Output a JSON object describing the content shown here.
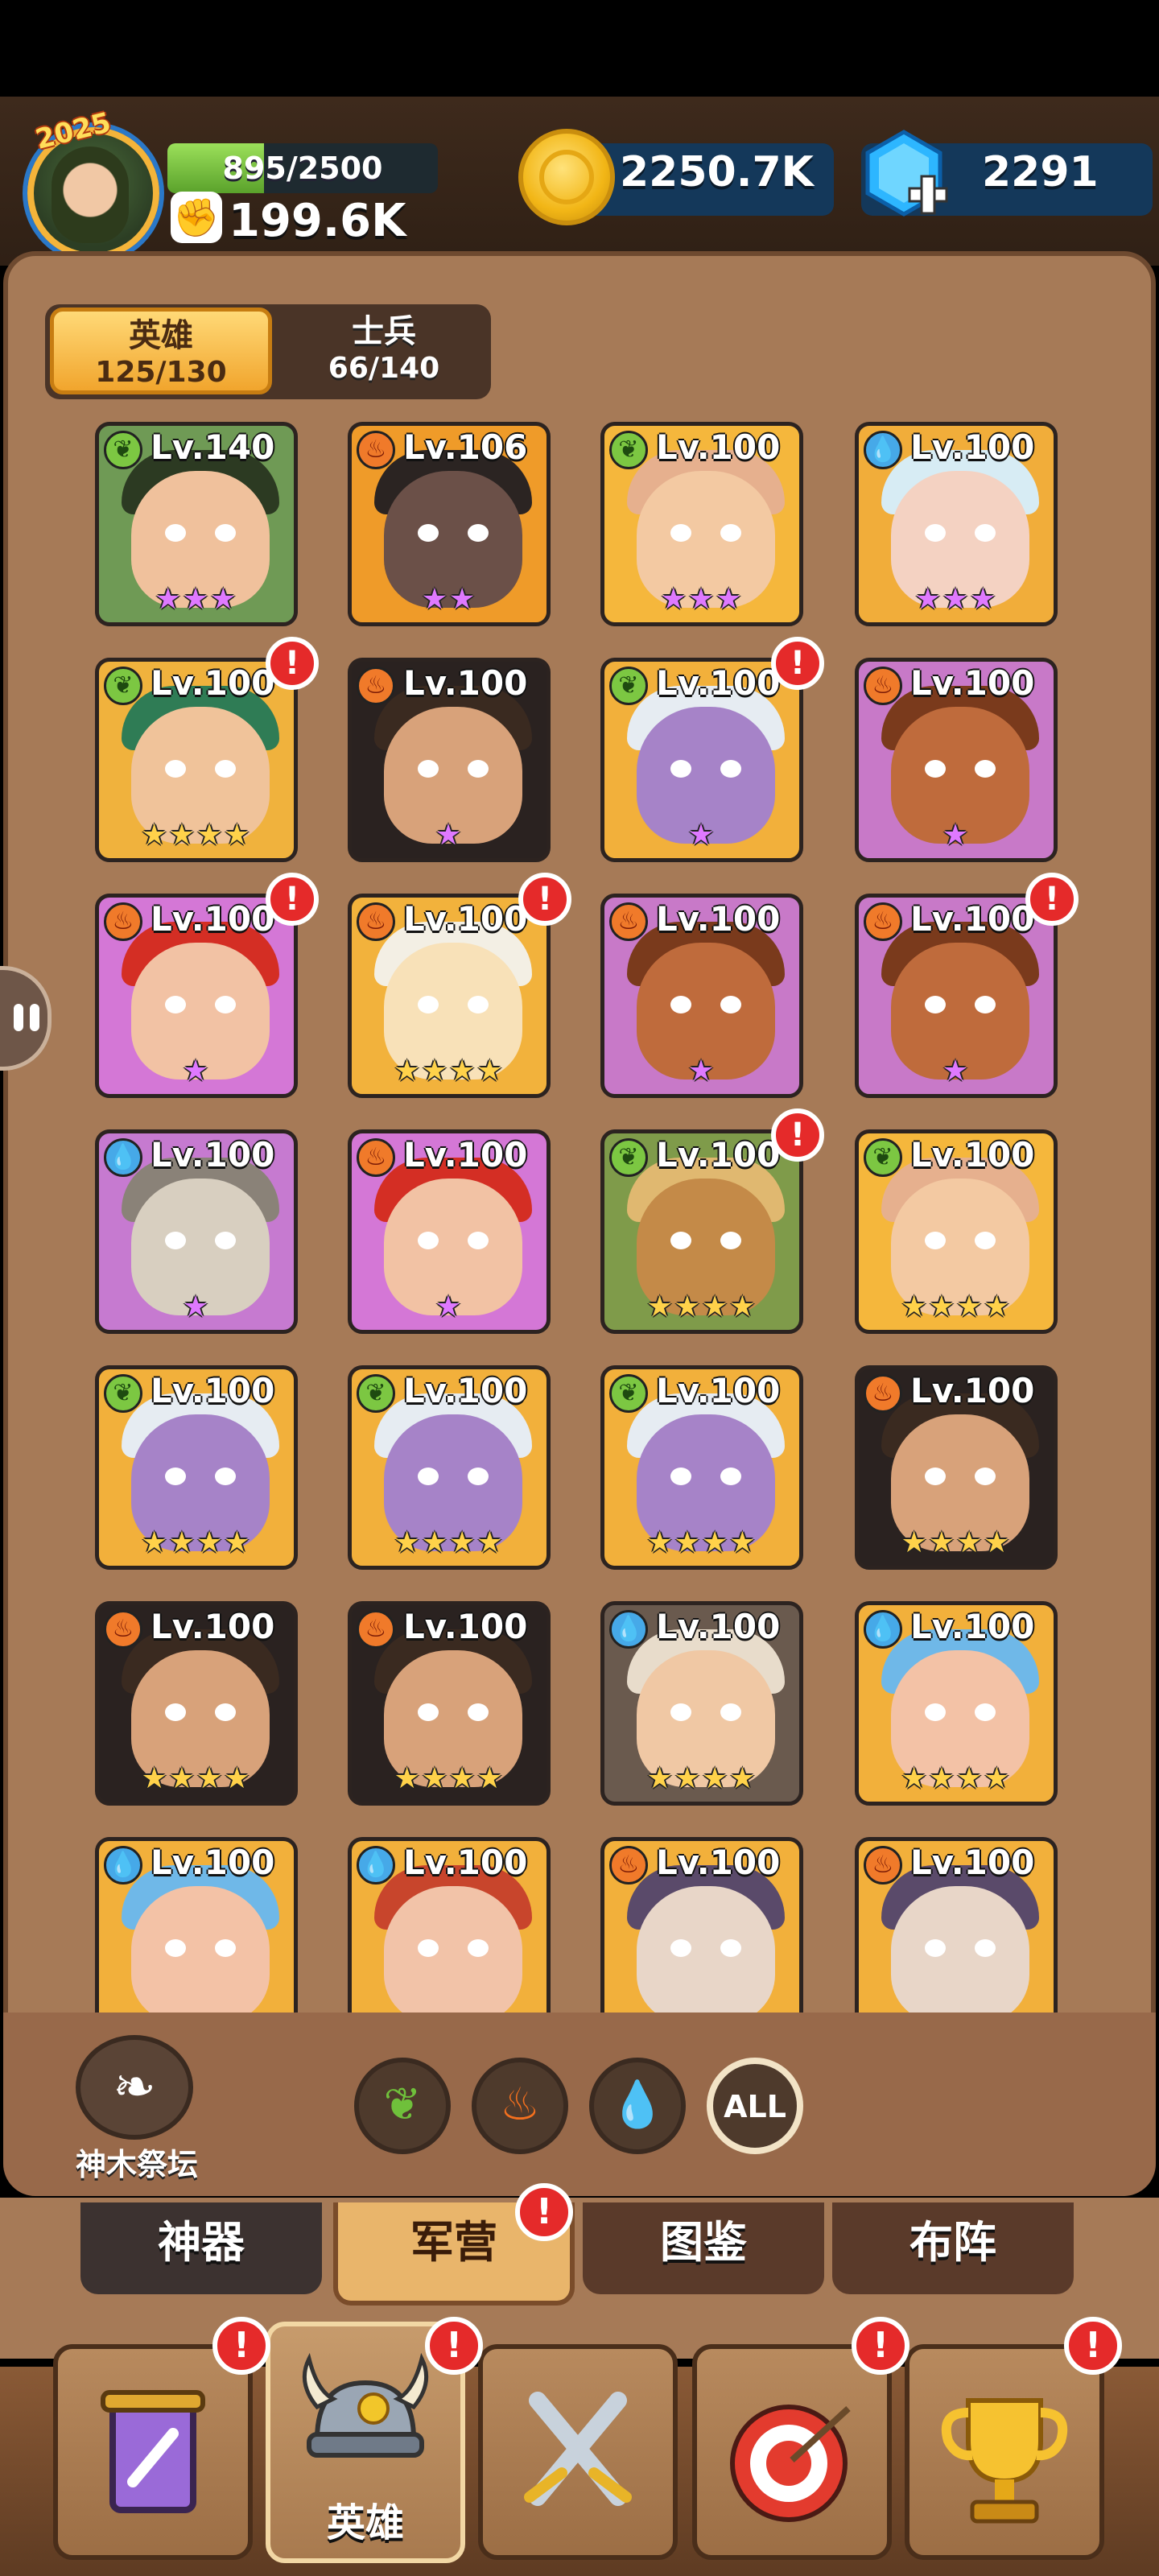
{
  "header": {
    "year_badge": "2025",
    "xp": "895/2500",
    "xp_fraction": 0.358,
    "power": "199.6K",
    "coins": "2250.7K",
    "gems": "2291"
  },
  "tabs": {
    "heroes": {
      "label": "英雄",
      "count": "125/130"
    },
    "soldiers": {
      "label": "士兵",
      "count": "66/140"
    }
  },
  "heroes": [
    {
      "element": "leaf",
      "level": "Lv.140",
      "stars": 3,
      "star_color": "purple",
      "alert": false,
      "bg": "#6f9a55",
      "skin": "#f0c19c",
      "hair": "#2c3a22"
    },
    {
      "element": "fire",
      "level": "Lv.106",
      "stars": 2,
      "star_color": "purple",
      "alert": false,
      "bg": "#ef9b29",
      "skin": "#6b5048",
      "hair": "#2b2422"
    },
    {
      "element": "leaf",
      "level": "Lv.100",
      "stars": 3,
      "star_color": "purple",
      "alert": false,
      "bg": "#f5b73c",
      "skin": "#f3c9a2",
      "hair": "#e6b08e"
    },
    {
      "element": "water",
      "level": "Lv.100",
      "stars": 3,
      "star_color": "purple",
      "alert": false,
      "bg": "#f1ad3a",
      "skin": "#f4d2c2",
      "hair": "#d7ecf4"
    },
    {
      "element": "leaf",
      "level": "Lv.100",
      "stars": 4,
      "star_color": "gold",
      "alert": true,
      "bg": "#f0b23d",
      "skin": "#f0c39a",
      "hair": "#2f7c55"
    },
    {
      "element": "fire",
      "level": "Lv.100",
      "stars": 1,
      "star_color": "purple",
      "alert": false,
      "bg": "#2a2220",
      "skin": "#d8a27a",
      "hair": "#3a2a20"
    },
    {
      "element": "leaf",
      "level": "Lv.100",
      "stars": 1,
      "star_color": "purple",
      "alert": true,
      "bg": "#f2b03b",
      "skin": "#a683c8",
      "hair": "#e6ecf2"
    },
    {
      "element": "fire",
      "level": "Lv.100",
      "stars": 1,
      "star_color": "purple",
      "alert": false,
      "bg": "#c879c8",
      "skin": "#bf6b3c",
      "hair": "#7a3a1c"
    },
    {
      "element": "fire",
      "level": "Lv.100",
      "stars": 1,
      "star_color": "purple",
      "alert": true,
      "bg": "#d477d6",
      "skin": "#f2c2a4",
      "hair": "#d42e24"
    },
    {
      "element": "fire",
      "level": "Lv.100",
      "stars": 4,
      "star_color": "gold",
      "alert": true,
      "bg": "#f2b23c",
      "skin": "#f8e1b8",
      "hair": "#f3efe4"
    },
    {
      "element": "fire",
      "level": "Lv.100",
      "stars": 1,
      "star_color": "purple",
      "alert": false,
      "bg": "#c879c8",
      "skin": "#bf6b3c",
      "hair": "#7a3a1c"
    },
    {
      "element": "fire",
      "level": "Lv.100",
      "stars": 1,
      "star_color": "purple",
      "alert": true,
      "bg": "#c879c8",
      "skin": "#bf6b3c",
      "hair": "#7a3a1c"
    },
    {
      "element": "water",
      "level": "Lv.100",
      "stars": 1,
      "star_color": "purple",
      "alert": false,
      "bg": "#c67ad0",
      "skin": "#d8cfc0",
      "hair": "#8a8278"
    },
    {
      "element": "fire",
      "level": "Lv.100",
      "stars": 1,
      "star_color": "purple",
      "alert": false,
      "bg": "#d477d6",
      "skin": "#f2c2a4",
      "hair": "#d42e24"
    },
    {
      "element": "leaf",
      "level": "Lv.100",
      "stars": 4,
      "star_color": "gold",
      "alert": true,
      "bg": "#7f9b4a",
      "skin": "#c48a48",
      "hair": "#e0b870"
    },
    {
      "element": "leaf",
      "level": "Lv.100",
      "stars": 4,
      "star_color": "gold",
      "alert": false,
      "bg": "#f5b73c",
      "skin": "#f3c9a2",
      "hair": "#e6b08e"
    },
    {
      "element": "leaf",
      "level": "Lv.100",
      "stars": 4,
      "star_color": "gold",
      "alert": false,
      "bg": "#f2b03b",
      "skin": "#a683c8",
      "hair": "#e6ecf2"
    },
    {
      "element": "leaf",
      "level": "Lv.100",
      "stars": 4,
      "star_color": "gold",
      "alert": false,
      "bg": "#f2b03b",
      "skin": "#a683c8",
      "hair": "#e6ecf2"
    },
    {
      "element": "leaf",
      "level": "Lv.100",
      "stars": 4,
      "star_color": "gold",
      "alert": false,
      "bg": "#f2b03b",
      "skin": "#a683c8",
      "hair": "#e6ecf2"
    },
    {
      "element": "fire",
      "level": "Lv.100",
      "stars": 4,
      "star_color": "gold",
      "alert": false,
      "bg": "#2a2220",
      "skin": "#d8a27a",
      "hair": "#3a2a20"
    },
    {
      "element": "fire",
      "level": "Lv.100",
      "stars": 4,
      "star_color": "gold",
      "alert": false,
      "bg": "#2a2220",
      "skin": "#d8a27a",
      "hair": "#3a2a20"
    },
    {
      "element": "fire",
      "level": "Lv.100",
      "stars": 4,
      "star_color": "gold",
      "alert": false,
      "bg": "#2a2220",
      "skin": "#d8a27a",
      "hair": "#3a2a20"
    },
    {
      "element": "water",
      "level": "Lv.100",
      "stars": 4,
      "star_color": "gold",
      "alert": false,
      "bg": "#6a5a4e",
      "skin": "#f0c8a4",
      "hair": "#e8dccb"
    },
    {
      "element": "water",
      "level": "Lv.100",
      "stars": 4,
      "star_color": "gold",
      "alert": false,
      "bg": "#f2b03b",
      "skin": "#f3c2a6",
      "hair": "#6fb8e8"
    },
    {
      "element": "water",
      "level": "Lv.100",
      "stars": 0,
      "star_color": "gold",
      "alert": false,
      "bg": "#f2b03b",
      "skin": "#f3c2a6",
      "hair": "#6fb8e8"
    },
    {
      "element": "water",
      "level": "Lv.100",
      "stars": 0,
      "star_color": "gold",
      "alert": false,
      "bg": "#f2b03b",
      "skin": "#f2c3a8",
      "hair": "#c8452c"
    },
    {
      "element": "fire",
      "level": "Lv.100",
      "stars": 0,
      "star_color": "gold",
      "alert": false,
      "bg": "#f2b03b",
      "skin": "#e8d6c8",
      "hair": "#5a4a6a"
    },
    {
      "element": "fire",
      "level": "Lv.100",
      "stars": 0,
      "star_color": "gold",
      "alert": false,
      "bg": "#f2b03b",
      "skin": "#e8d6c8",
      "hair": "#5a4a6a"
    }
  ],
  "element_icons": {
    "leaf": "❦",
    "fire": "♨",
    "water": "💧"
  },
  "altar": {
    "label": "神木祭坛"
  },
  "filters": {
    "all_label": "ALL"
  },
  "sub_tabs": [
    "神器",
    "军营",
    "图鉴",
    "布阵"
  ],
  "nav": {
    "heroes_label": "英雄"
  },
  "alert_mark": "!"
}
